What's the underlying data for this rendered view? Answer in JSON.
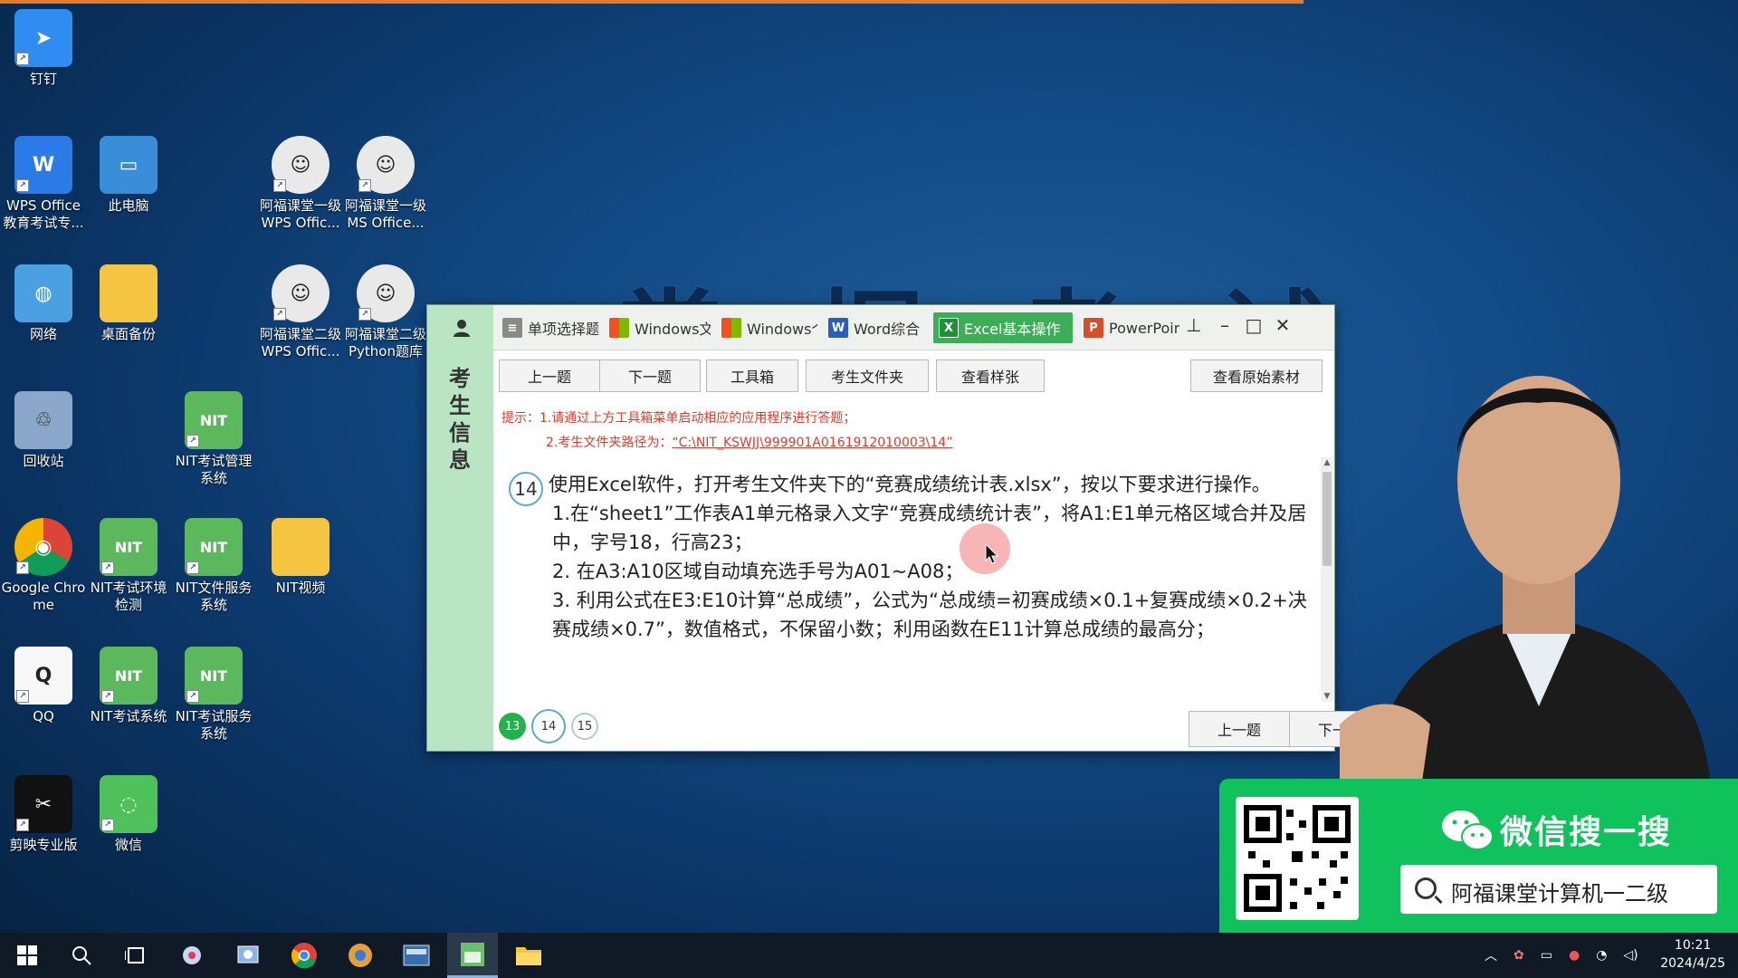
{
  "background": {
    "title": "掌 握 考 试"
  },
  "desktop": {
    "icons": [
      {
        "id": "dingtalk",
        "label": "钉钉",
        "icon": "dingtalk-icon"
      },
      {
        "id": "wps",
        "label": "WPS Office 教育考试专...",
        "icon": "wps-icon"
      },
      {
        "id": "this-pc",
        "label": "此电脑",
        "icon": "computer-icon"
      },
      {
        "id": "afu-wps1",
        "label": "阿福课堂一级 WPS Offic...",
        "icon": "avatar-icon"
      },
      {
        "id": "afu-ms1",
        "label": "阿福课堂一级 MS Office...",
        "icon": "avatar-icon"
      },
      {
        "id": "network",
        "label": "网络",
        "icon": "network-icon"
      },
      {
        "id": "backup",
        "label": "桌面备份",
        "icon": "folder-icon"
      },
      {
        "id": "afu-wps2",
        "label": "阿福课堂二级 WPS Offic...",
        "icon": "avatar-icon"
      },
      {
        "id": "afu-py2",
        "label": "阿福课堂二级 Python题库",
        "icon": "avatar-icon"
      },
      {
        "id": "recycle",
        "label": "回收站",
        "icon": "recycle-bin-icon"
      },
      {
        "id": "nit-mgmt",
        "label": "NIT考试管理 系统",
        "icon": "nit-icon"
      },
      {
        "id": "chrome",
        "label": "Google Chrome",
        "icon": "chrome-icon"
      },
      {
        "id": "nit-env",
        "label": "NIT考试环境 检测",
        "icon": "nit-icon"
      },
      {
        "id": "nit-file",
        "label": "NIT文件服务 系统",
        "icon": "nit-icon"
      },
      {
        "id": "nit-video",
        "label": "NIT视频",
        "icon": "folder-icon"
      },
      {
        "id": "qq",
        "label": "QQ",
        "icon": "qq-icon"
      },
      {
        "id": "nit-exam",
        "label": "NIT考试系统",
        "icon": "nit-icon"
      },
      {
        "id": "nit-svc",
        "label": "NIT考试服务 系统",
        "icon": "nit-icon"
      },
      {
        "id": "capcut",
        "label": "剪映专业版",
        "icon": "capcut-icon"
      },
      {
        "id": "wechat",
        "label": "微信",
        "icon": "wechat-icon"
      }
    ]
  },
  "window": {
    "side_label": "考生信息",
    "tabs": [
      {
        "label": "单项选择题",
        "icon": "doc-icon",
        "color": "#8a8a8a"
      },
      {
        "label": "Windows文",
        "icon": "windows-icon",
        "color": "#2f7bd8"
      },
      {
        "label": "Windows个",
        "icon": "windows-icon",
        "color": "#2f7bd8"
      },
      {
        "label": "Word综合",
        "icon": "word-icon",
        "color": "#2b5eb8"
      },
      {
        "label": "Excel基本操作",
        "icon": "excel-icon",
        "color": "#1f8f3a",
        "active": true
      },
      {
        "label": "PowerPoin",
        "icon": "powerpoint-icon",
        "color": "#d4502b"
      }
    ],
    "toolbar": {
      "prev": "上一题",
      "next": "下一题",
      "toolbox": "工具箱",
      "folder": "考生文件夹",
      "sample": "查看样张",
      "original": "查看原始素材"
    },
    "hint": {
      "line1": "提示：1.请通过上方工具箱菜单启动相应的应用程序进行答题；",
      "line2_prefix": "2.考生文件夹路径为：",
      "line2_path": "“C:\\NIT_KSWJJ\\999901A0161912010003\\14”"
    },
    "question": {
      "number": "14",
      "lines": [
        "使用Excel软件，打开考生文件夹下的“竞赛成绩统计表.xlsx”，按以下要求进行操作。",
        "1.在“sheet1”工作表A1单元格录入文字“竞赛成绩统计表”，将A1:E1单元格区域合并及居中，字号18，行高23；",
        "2. 在A3:A10区域自动填充选手号为A01~A08；",
        "3. 利用公式在E3:E10计算“总成绩”，公式为“总成绩=初赛成绩×0.1+复赛成绩×0.2+决赛成绩×0.7”，数值格式，不保留小数；利用函数在E11计算总成绩的最高分；"
      ]
    },
    "pager": {
      "items": [
        "13",
        "14",
        "15"
      ],
      "prev": "上一题",
      "next": "下一题"
    }
  },
  "wechat_banner": {
    "title": "微信搜一搜",
    "query": "阿福课堂计算机一二级"
  },
  "taskbar": {
    "apps": [
      "start-icon",
      "search-icon",
      "task-view-icon",
      "app-icon",
      "app-icon",
      "chrome-icon",
      "app-icon",
      "app-icon",
      "nit-icon",
      "file-explorer-icon"
    ],
    "time": "10:21",
    "date": "2024/4/25"
  }
}
